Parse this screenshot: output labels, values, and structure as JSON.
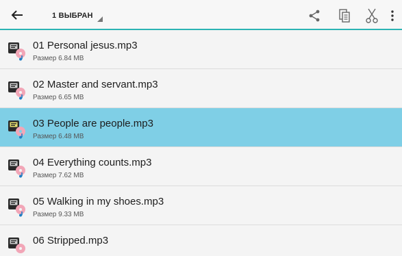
{
  "header": {
    "selection_label": "1 ВЫБРАН",
    "accent_color": "#2bb3b3",
    "icons": [
      "back-arrow-icon",
      "share-icon",
      "copy-icon",
      "cut-icon",
      "more-vert-icon"
    ]
  },
  "files": [
    {
      "name": "01 Personal jesus.mp3",
      "size": "Размер 6.84 MB",
      "selected": false
    },
    {
      "name": "02 Master and servant.mp3",
      "size": "Размер 6.65 MB",
      "selected": false
    },
    {
      "name": "03 People are people.mp3",
      "size": "Размер 6.48 MB",
      "selected": true
    },
    {
      "name": "04 Everything counts.mp3",
      "size": "Размер 7.62 MB",
      "selected": false
    },
    {
      "name": "05 Walking in my shoes.mp3",
      "size": "Размер 9.33 MB",
      "selected": false
    },
    {
      "name": "06 Stripped.mp3",
      "size": "",
      "selected": false
    }
  ],
  "colors": {
    "selected_row": "#7fcfe6",
    "background": "#f4f4f4"
  }
}
